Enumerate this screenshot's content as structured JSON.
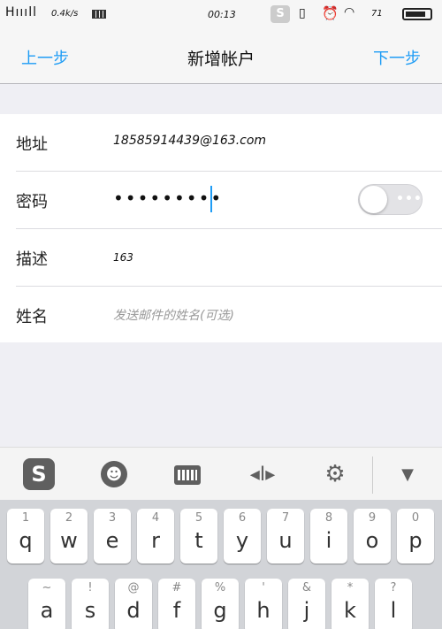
{
  "status": {
    "signal": "H",
    "signal_bars": "ıııll",
    "speed": "0.4k/s",
    "time": "00:13",
    "sogou": "S",
    "battery_pct": "71",
    "icons": [
      "grid-icon",
      "vibrate-icon",
      "alarm-icon",
      "wifi-icon",
      "battery-icon"
    ]
  },
  "nav": {
    "prev": "上一步",
    "title": "新增帐户",
    "next": "下一步"
  },
  "form": {
    "address_label": "地址",
    "address_value": "18585914439@163.com",
    "password_label": "密码",
    "password_value": "•••••••••",
    "toggle_dots": "•••",
    "desc_label": "描述",
    "desc_value": "163",
    "name_label": "姓名",
    "name_placeholder": "发送邮件的姓名(可选)"
  },
  "ime_toolbar": {
    "logo": "S",
    "icons": [
      "sogou-logo-icon",
      "emoji-icon",
      "keyboard-icon",
      "cursor-icon",
      "gear-icon",
      "chevron-down-icon"
    ]
  },
  "keyboard": {
    "row1": [
      {
        "num": "1",
        "ch": "q"
      },
      {
        "num": "2",
        "ch": "w"
      },
      {
        "num": "3",
        "ch": "e"
      },
      {
        "num": "4",
        "ch": "r"
      },
      {
        "num": "5",
        "ch": "t"
      },
      {
        "num": "6",
        "ch": "y"
      },
      {
        "num": "7",
        "ch": "u"
      },
      {
        "num": "8",
        "ch": "i"
      },
      {
        "num": "9",
        "ch": "o"
      },
      {
        "num": "0",
        "ch": "p"
      }
    ],
    "row2": [
      {
        "num": "~",
        "ch": "a"
      },
      {
        "num": "!",
        "ch": "s"
      },
      {
        "num": "@",
        "ch": "d"
      },
      {
        "num": "#",
        "ch": "f"
      },
      {
        "num": "%",
        "ch": "g"
      },
      {
        "num": "'",
        "ch": "h"
      },
      {
        "num": "&",
        "ch": "j"
      },
      {
        "num": "*",
        "ch": "k"
      },
      {
        "num": "?",
        "ch": "l"
      }
    ]
  }
}
